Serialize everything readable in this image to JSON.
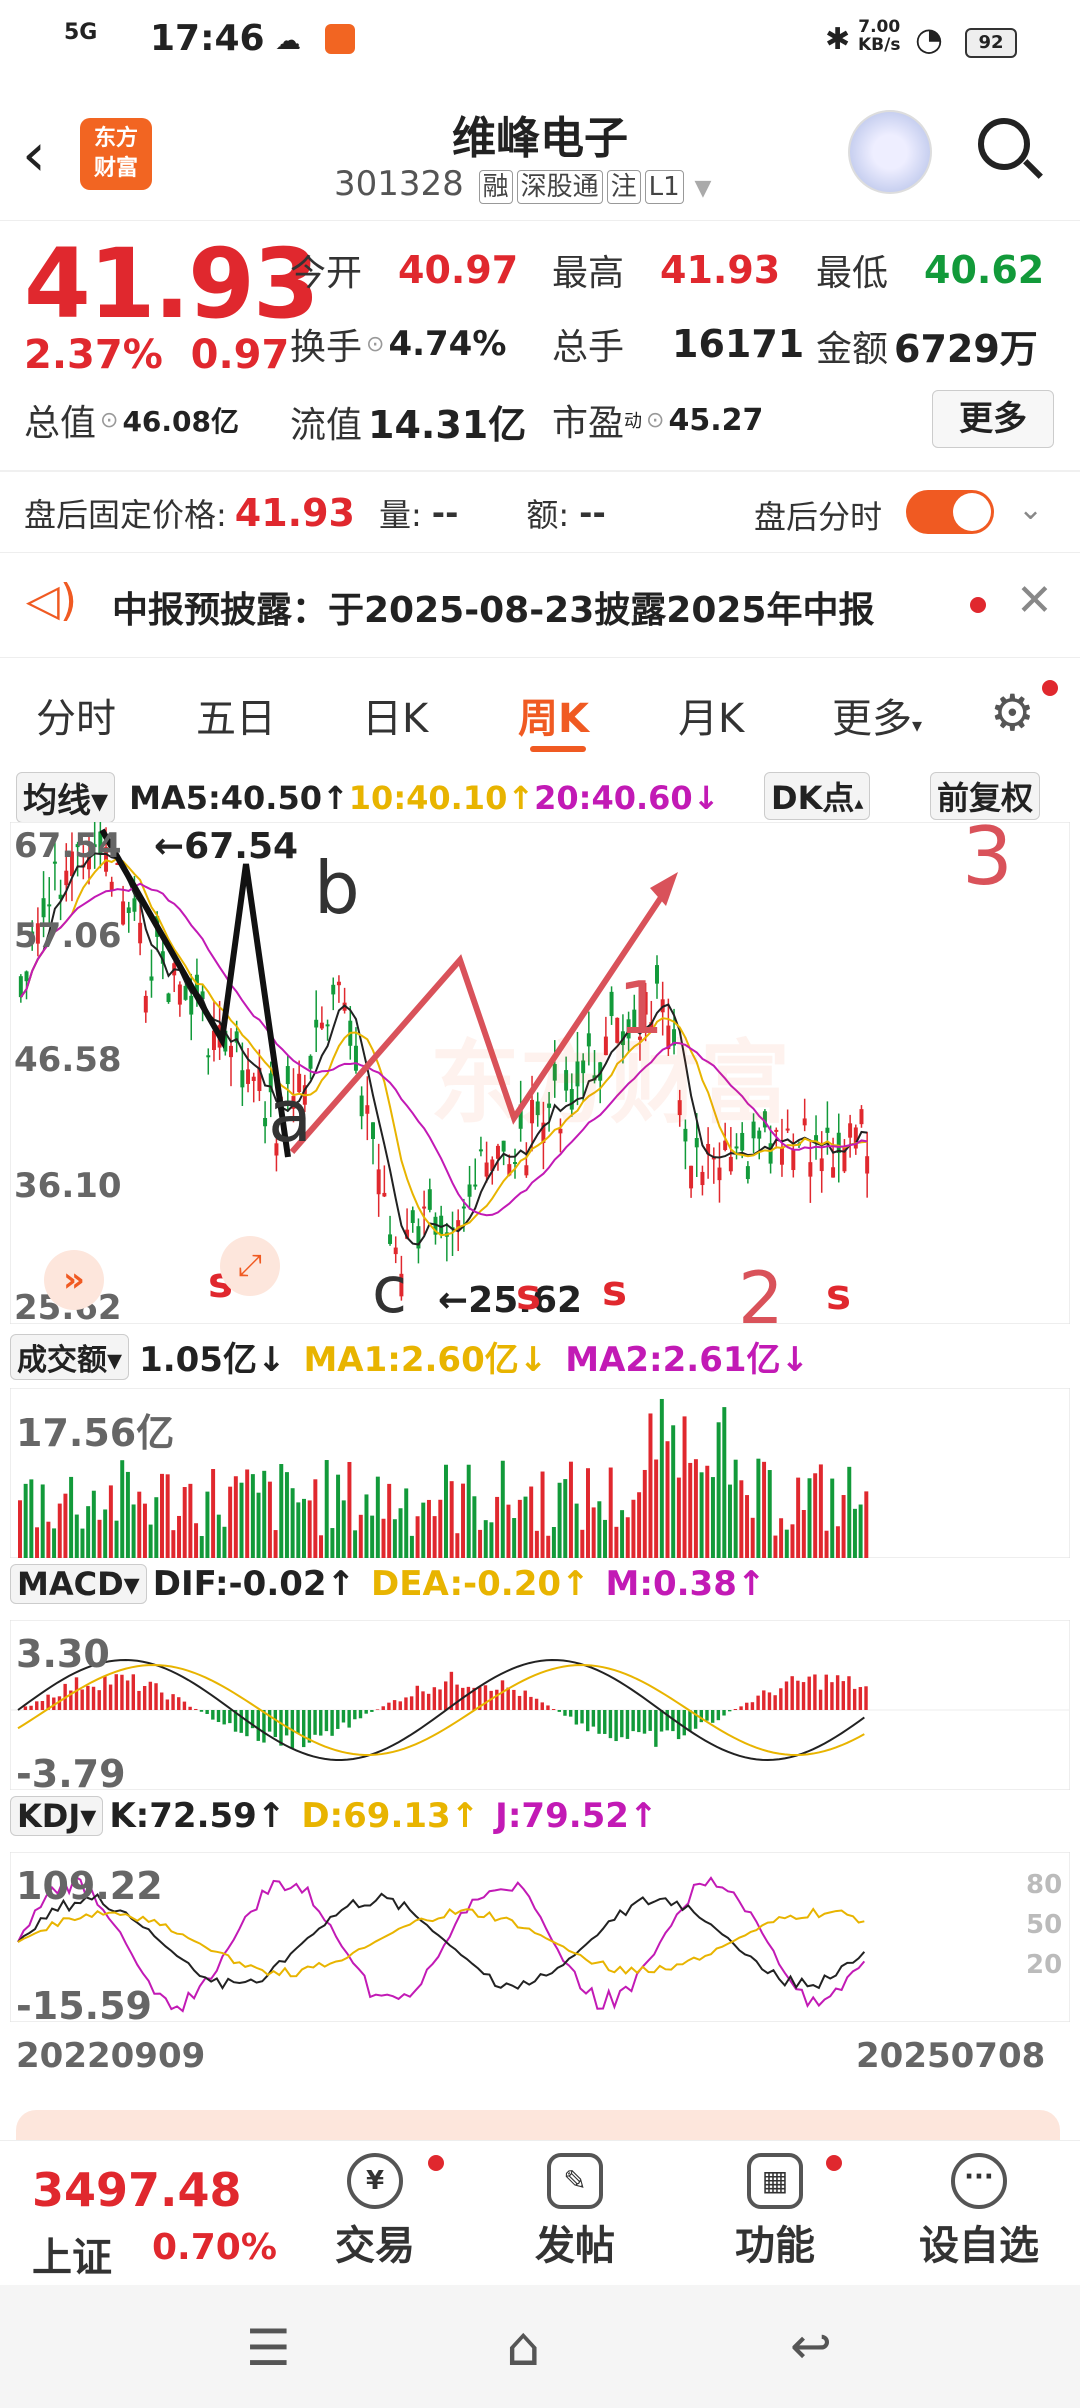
{
  "status_bar": {
    "time": "17:46",
    "network": "5G",
    "speed": "7.00\nKB/s",
    "battery": "92"
  },
  "header": {
    "logo": "东方\n财富",
    "title": "维峰电子",
    "code": "301328",
    "tags": [
      "融",
      "深股通",
      "注",
      "L1"
    ]
  },
  "quote": {
    "price": "41.93",
    "change_pct": "2.37%",
    "change_amt": "0.97",
    "open_label": "今开",
    "open": "40.97",
    "high_label": "最高",
    "high": "41.93",
    "low_label": "最低",
    "low": "40.62",
    "turnover_label": "换手",
    "turnover": "4.74%",
    "volume_label": "总手",
    "volume": "16171",
    "amount_label": "金额",
    "amount": "6729万",
    "mktcap_label": "总值",
    "mktcap": "46.08亿",
    "float_label": "流值",
    "float": "14.31亿",
    "pe_label": "市盈",
    "pe_sup": "动",
    "pe": "45.27",
    "more_button": "更多"
  },
  "after_hours": {
    "price_label": "盘后固定价格:",
    "price": "41.93",
    "qty_label": "量:",
    "qty": "--",
    "amt_label": "额:",
    "amt": "--",
    "toggle_label": "盘后分时"
  },
  "notice": {
    "text": "中报预披露：于2025-08-23披露2025年中报"
  },
  "tabs": [
    "分时",
    "五日",
    "日K",
    "周K",
    "月K",
    "更多"
  ],
  "active_tab": "周K",
  "ma_legend": {
    "selector": "均线",
    "ma5": "MA5:40.50↑",
    "ma10": "10:40.10↑",
    "ma20": "20:40.60↓",
    "dk_button": "DK点",
    "fq_button": "前复权"
  },
  "price_axis": [
    "67.54",
    "57.06",
    "46.58",
    "36.10",
    "25.62"
  ],
  "price_annotations": {
    "high_mark": "←67.54",
    "low_mark": "←25.62",
    "a": "a",
    "b": "b",
    "c": "c",
    "w1": "1",
    "w2": "2",
    "w3": "3",
    "s_marks": [
      "s",
      "s",
      "s",
      "s"
    ]
  },
  "volume_legend": {
    "selector": "成交额",
    "value": "1.05亿↓",
    "ma1": "MA1:2.60亿↓",
    "ma2": "MA2:2.61亿↓",
    "axis_top": "17.56亿"
  },
  "macd_legend": {
    "selector": "MACD",
    "dif": "DIF:-0.02↑",
    "dea": "DEA:-0.20↑",
    "m": "M:0.38↑",
    "axis_top": "3.30",
    "axis_bottom": "-3.79"
  },
  "kdj_legend": {
    "selector": "KDJ",
    "k": "K:72.59↑",
    "d": "D:69.13↑",
    "j": "J:79.52↑",
    "axis_top": "109.22",
    "axis_bottom": "-15.59",
    "right_ticks": [
      "80",
      "50",
      "20"
    ]
  },
  "date_range": {
    "start": "20220909",
    "end": "20250708"
  },
  "bottom_bar": {
    "index_value": "3497.48",
    "index_name": "上证",
    "index_pct": "0.70%",
    "items": [
      "交易",
      "发帖",
      "功能",
      "设自选"
    ]
  },
  "colors": {
    "up": "#e0282e",
    "down": "#129a3a",
    "accent": "#f05a22",
    "ma5": "#222222",
    "ma10": "#e8b400",
    "ma20": "#c21ab5"
  }
}
